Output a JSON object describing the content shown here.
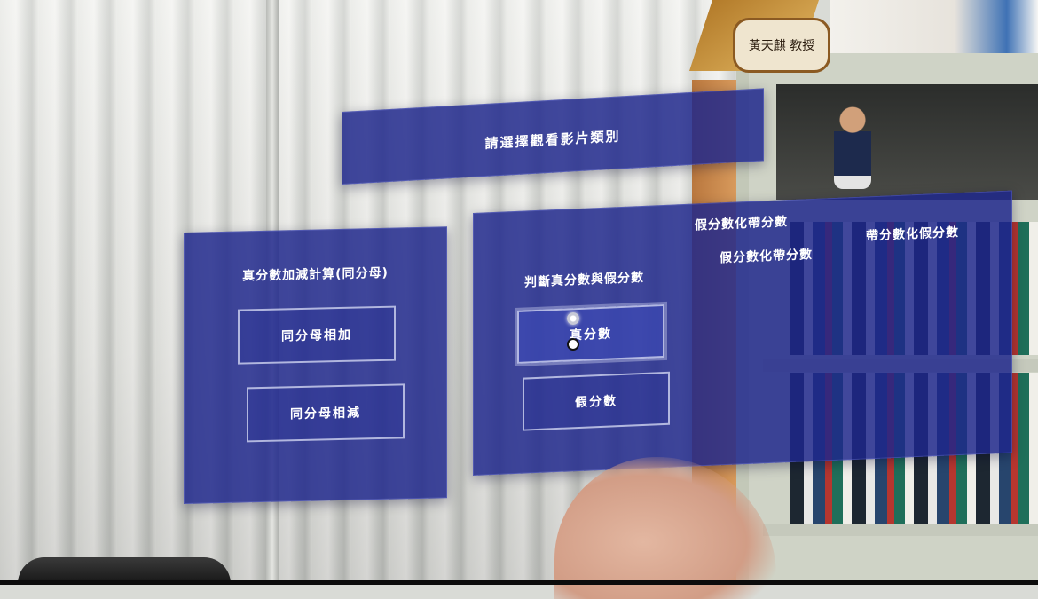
{
  "background": {
    "nameplate_text": "黃天麒 教授"
  },
  "title_panel": {
    "title": "請選擇觀看影片類別"
  },
  "left_panel": {
    "heading": "真分數加減計算(同分母)",
    "buttons": [
      {
        "label": "同分母相加"
      },
      {
        "label": "同分母相減"
      }
    ]
  },
  "main_panel": {
    "section_title": "假分數化帶分數",
    "judge_heading": "判斷真分數與假分數",
    "col2_heading": "假分數化帶分數",
    "col3_heading": "帶分數化假分數",
    "buttons": [
      {
        "label": "真分數"
      },
      {
        "label": "假分數"
      }
    ]
  },
  "colors": {
    "panel_bg": "#1e268c",
    "panel_text": "#ffffff",
    "button_border": "#c8cdeb"
  }
}
